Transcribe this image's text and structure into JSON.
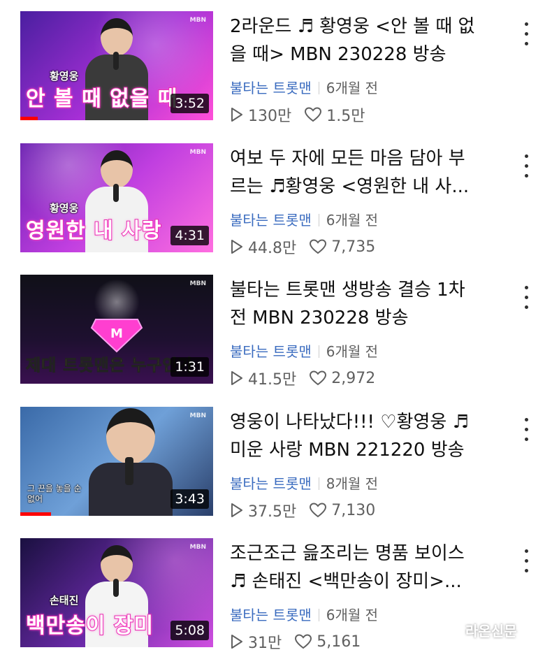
{
  "videos": [
    {
      "title_line1": "2라운드 ♬ 황영웅 <안 볼 때 없",
      "title_line2": "을 때> MBN 230228 방송",
      "channel": "불타는 트롯맨",
      "age": "6개월 전",
      "views": "130만",
      "likes": "1.5만",
      "duration": "3:52",
      "thumb_caption": "안 볼 때 없을 때",
      "thumb_label": "황영웅",
      "progress_fraction": 0.09
    },
    {
      "title_line1": "여보 두 자에 모든 마음 담아 부",
      "title_line2": "르는 ♬황영웅 <영원한 내 사...",
      "channel": "불타는 트롯맨",
      "age": "6개월 전",
      "views": "44.8만",
      "likes": "7,735",
      "duration": "4:31",
      "thumb_caption": "영원한 내 사랑",
      "thumb_label": "황영웅",
      "progress_fraction": 0
    },
    {
      "title_line1": "불타는 트롯맨 생방송 결승 1차",
      "title_line2": "전 MBN 230228 방송",
      "channel": "불타는 트롯맨",
      "age": "6개월 전",
      "views": "41.5만",
      "likes": "2,972",
      "duration": "1:31",
      "thumb_caption": "제대 트롯맨은 누구인가",
      "thumb_label": "",
      "progress_fraction": 0
    },
    {
      "title_line1": "영웅이 나타났다!!! ♡황영웅 ♬",
      "title_line2": "미운 사랑 MBN 221220 방송",
      "channel": "불타는 트롯맨",
      "age": "8개월 전",
      "views": "37.5만",
      "likes": "7,130",
      "duration": "3:43",
      "thumb_caption": "그 끈을 놓을 순 없어",
      "thumb_label": "",
      "progress_fraction": 0.16
    },
    {
      "title_line1": "조근조근 읊조리는 명품 보이스",
      "title_line2": "♬ 손태진 <백만송이 장미>...",
      "channel": "불타는 트롯맨",
      "age": "6개월 전",
      "views": "31만",
      "likes": "5,161",
      "duration": "5:08",
      "thumb_caption": "백만송이 장미",
      "thumb_label": "손태진",
      "progress_fraction": 0
    }
  ],
  "thumb_logo": "MBN",
  "watermark": "라온신문",
  "colors": {
    "progress": "#ff0000",
    "channel_link": "#3a6bbf",
    "meta_text": "#606060"
  },
  "icons": {
    "views": "play-outline-icon",
    "likes": "heart-outline-icon",
    "more": "more-vertical-icon"
  }
}
